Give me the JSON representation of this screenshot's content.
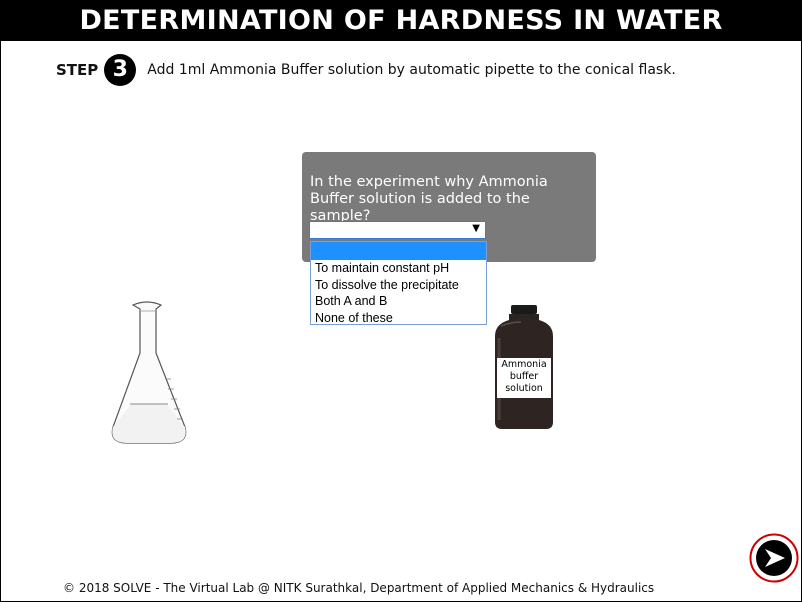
{
  "title": "DETERMINATION OF HARDNESS IN WATER",
  "step": {
    "word": "STEP",
    "number": "3",
    "instruction": "Add 1ml Ammonia Buffer solution by automatic pipette to the conical flask."
  },
  "quiz": {
    "question": "In the experiment why Ammonia Buffer solution is added to the sample?",
    "selected_value": "",
    "options": [
      "",
      "To maintain constant pH",
      "To dissolve the precipitate",
      "Both A and B",
      "None of these"
    ],
    "highlighted_option_index": 0,
    "highlight_color": "#1e90ff"
  },
  "apparatus": {
    "bottle_label_lines": [
      "Ammonia",
      "buffer",
      "solution"
    ],
    "flask_icon": "conical-flask",
    "bottle_icon": "reagent-bottle"
  },
  "navigation": {
    "next_icon": "next-arrow-icon",
    "next_ring_color": "#cc0000"
  },
  "footer": "© 2018 SOLVE - The Virtual Lab @ NITK Surathkal, Department of Applied Mechanics & Hydraulics"
}
